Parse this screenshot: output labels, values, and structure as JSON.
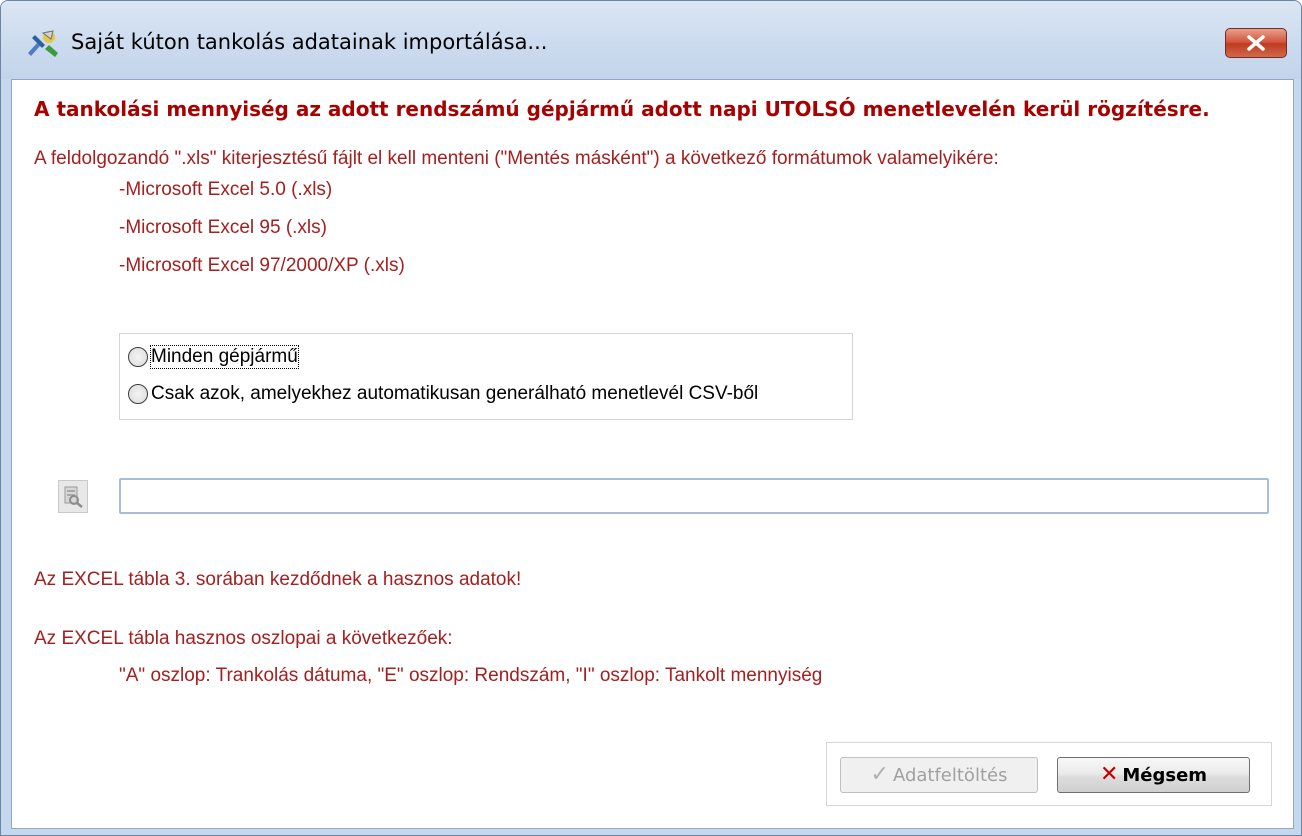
{
  "window": {
    "title": "Saját kúton tankolás adatainak importálása...",
    "icon": "app-logo-icon",
    "close_icon": "close-icon",
    "accent_close": "#c13a20"
  },
  "notice": "A tankolási mennyiség az adott rendszámú gépjármű adott napi UTOLSÓ menetlevelén kerül rögzítésre.",
  "intro": "A feldolgozandó \".xls\" kiterjesztésű fájlt el kell menteni (\"Mentés másként\") a következő formátumok valamelyikére:",
  "formats": [
    "-Microsoft Excel 5.0 (.xls)",
    "-Microsoft Excel 95 (.xls)",
    "-Microsoft Excel 97/2000/XP (.xls)"
  ],
  "options": [
    {
      "label": "Minden gépjármű",
      "selected": false,
      "focused": true
    },
    {
      "label": "Csak azok, amelyekhez automatikusan generálható menetlevél CSV-ből",
      "selected": false,
      "focused": false
    }
  ],
  "file": {
    "browse_icon": "file-browse-icon",
    "value": "",
    "placeholder": ""
  },
  "info": {
    "start_row": "Az EXCEL tábla 3. sorában kezdődnek a hasznos adatok!",
    "columns_title": "Az EXCEL tábla hasznos oszlopai a következőek:",
    "columns": "\"A\" oszlop: Trankolás dátuma, \"E\" oszlop: Rendszám, \"I\" oszlop: Tankolt mennyiség"
  },
  "buttons": {
    "upload": {
      "label": "Adatfeltöltés",
      "icon": "checkmark-icon",
      "enabled": false
    },
    "cancel": {
      "label": "Mégsem",
      "icon": "x-icon",
      "enabled": true
    }
  },
  "colors": {
    "text_red": "#a42020",
    "notice_red": "#a90000",
    "frame": "#c6d8ee"
  }
}
